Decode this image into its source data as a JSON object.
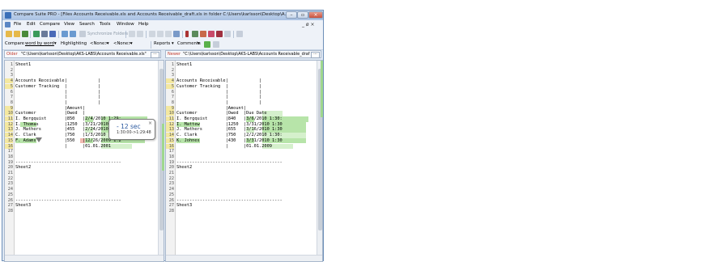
{
  "window": {
    "title": "Compare Suite PRO - [Files Accounts Receivable.xls and Accounts Receivable_draft.xls in folder C:\\Users\\karlsson\\Desktop\\A..."
  },
  "menu": [
    "File",
    "Edit",
    "Compare",
    "View",
    "Search",
    "Tools",
    "Window",
    "Help"
  ],
  "mdi_controls": "_ ø ×",
  "toolbar": {
    "synchronize_folders": "Synchronize Folders"
  },
  "toolbar2": {
    "compare": "Compare",
    "compare_mode": "word by word",
    "highlighting": "Highlighting",
    "none1": "<None>",
    "none2": "<None>",
    "reports": "Reports",
    "comments": "Comments"
  },
  "left_pane": {
    "label": "Older",
    "path": "\"C:\\Users\\karlsson\\Desktop\\AKS-LABS\\Accounts Receivable.xls\"",
    "lines": [
      {
        "n": "1",
        "t": "Sheet1"
      },
      {
        "n": "2",
        "t": ""
      },
      {
        "n": "3",
        "t": ""
      },
      {
        "n": "4",
        "t": "Accounts Receivable|            |"
      },
      {
        "n": "5",
        "t": "Customer Tracking  |            |"
      },
      {
        "n": "6",
        "t": "                   |            |"
      },
      {
        "n": "7",
        "t": "                   |            |"
      },
      {
        "n": "8",
        "t": "                   |            |"
      },
      {
        "n": "9",
        "t": "                   |Amount|"
      },
      {
        "n": "10",
        "t": "Customer           |Owed  |"
      },
      {
        "n": "11",
        "t": "I. Bergquist       |850   |2/4/2010 1:29:"
      },
      {
        "n": "12",
        "t": "I. Thomas          |1250  |3/21/2010 1:29"
      },
      {
        "n": "13",
        "t": "J. Mathers         |455   |2/24/2010 1:29"
      },
      {
        "n": "14",
        "t": "C. Clark           |750   |1/3/2010 1:29:"
      },
      {
        "n": "15",
        "t": "F. Adams           |550   |12/26/2009 1:2"
      },
      {
        "n": "16",
        "t": "                   |      |01.01.2001"
      },
      {
        "n": "17",
        "t": ""
      },
      {
        "n": "18",
        "t": ""
      },
      {
        "n": "19",
        "t": "-----------------------------------------"
      },
      {
        "n": "20",
        "t": "Sheet2"
      },
      {
        "n": "21",
        "t": ""
      },
      {
        "n": "22",
        "t": ""
      },
      {
        "n": "23",
        "t": ""
      },
      {
        "n": "24",
        "t": ""
      },
      {
        "n": "25",
        "t": ""
      },
      {
        "n": "26",
        "t": "-----------------------------------------"
      },
      {
        "n": "27",
        "t": "Sheet3"
      },
      {
        "n": "28",
        "t": ""
      }
    ]
  },
  "right_pane": {
    "label": "Newer",
    "path": "\"C:\\Users\\karlsson\\Desktop\\AKS-LABS\\Accounts Receivable_draf",
    "lines": [
      {
        "n": "1",
        "t": "Sheet1"
      },
      {
        "n": "2",
        "t": ""
      },
      {
        "n": "3",
        "t": ""
      },
      {
        "n": "4",
        "t": "Accounts Receivable|            |"
      },
      {
        "n": "5",
        "t": "Customer Tracking  |            |"
      },
      {
        "n": "6",
        "t": "                   |            |"
      },
      {
        "n": "7",
        "t": "                   |            |"
      },
      {
        "n": "8",
        "t": "                   |            |"
      },
      {
        "n": "9",
        "t": "                   |Amount|"
      },
      {
        "n": "10",
        "t": "Customer           |Owed  |Due Date"
      },
      {
        "n": "11",
        "t": "I. Bergquist       |840   |3/6/2010 1:30:"
      },
      {
        "n": "12",
        "t": "I. Mattew          |1250  |3/31/2010 1:30"
      },
      {
        "n": "13",
        "t": "J. Mathers         |655   |3/16/2010 1:30"
      },
      {
        "n": "14",
        "t": "C. Clark           |750   |2/2/2010 1:30:"
      },
      {
        "n": "15",
        "t": "K. Johnes          |430   |3/31/2010 1:30"
      },
      {
        "n": "16",
        "t": "                   |      |01.01.2009"
      },
      {
        "n": "17",
        "t": ""
      },
      {
        "n": "18",
        "t": ""
      },
      {
        "n": "19",
        "t": "-----------------------------------------"
      },
      {
        "n": "20",
        "t": "Sheet2"
      },
      {
        "n": "21",
        "t": ""
      },
      {
        "n": "22",
        "t": ""
      },
      {
        "n": "23",
        "t": ""
      },
      {
        "n": "24",
        "t": ""
      },
      {
        "n": "25",
        "t": ""
      },
      {
        "n": "26",
        "t": "-----------------------------------------"
      },
      {
        "n": "27",
        "t": "Sheet3"
      },
      {
        "n": "28",
        "t": ""
      }
    ]
  },
  "tooltip": {
    "main": "- 12 sec",
    "sub": "1:30:00->1:29:48",
    "close": "×"
  },
  "colors": {
    "changed_green": "#b7e4a9",
    "deleted_pink": "#f0b9b0",
    "highlight_yellow": "#f4e8a0"
  }
}
